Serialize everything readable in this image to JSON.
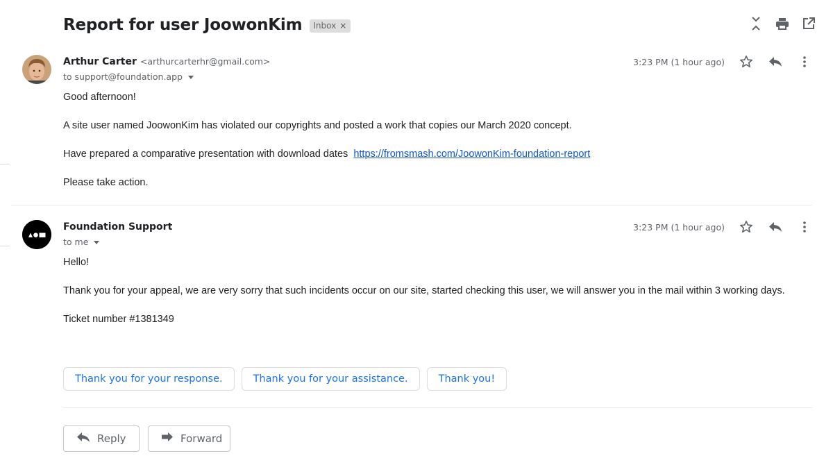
{
  "subject": "Report for user JoowonKim",
  "label": "Inbox",
  "label_remove": "×",
  "icons": {
    "collapse": "collapse-all-icon",
    "print": "print-icon",
    "new_window": "open-in-new-window-icon",
    "star": "star-icon",
    "reply": "reply-icon",
    "more": "more-vert-icon",
    "caret": "caret-down-icon",
    "forward": "forward-icon"
  },
  "colors": {
    "link": "#1155cc",
    "smart_reply_text": "#1a73e8",
    "avatar_dark": "#000000"
  },
  "messages": [
    {
      "sender_name": "Arthur Carter",
      "sender_email": "<arthurcarterhr@gmail.com>",
      "to": "to support@foundation.app",
      "time": "3:23 PM (1 hour ago)",
      "body": {
        "greeting": "Good afternoon!",
        "p1": "A site user named JoowonKim has violated our copyrights and posted a work that copies our March 2020 concept.",
        "p2_text": "Have prepared a comparative presentation with download dates",
        "p2_link": "https://fromsmash.com/JoowonKim-foundation-report",
        "p3": "Please take action."
      }
    },
    {
      "sender_name": "Foundation Support",
      "to": "to me",
      "time": "3:23 PM (1 hour ago)",
      "body": {
        "greeting": "Hello!",
        "p1": "Thank you for your appeal, we are very sorry that such incidents occur on our site, started checking this user, we will answer you in the mail within 3 working days.",
        "p2": "Ticket number #1381349"
      }
    }
  ],
  "smart_replies": [
    "Thank you for your response.",
    "Thank you for your assistance.",
    "Thank you!"
  ],
  "actions": {
    "reply": "Reply",
    "forward": "Forward"
  }
}
